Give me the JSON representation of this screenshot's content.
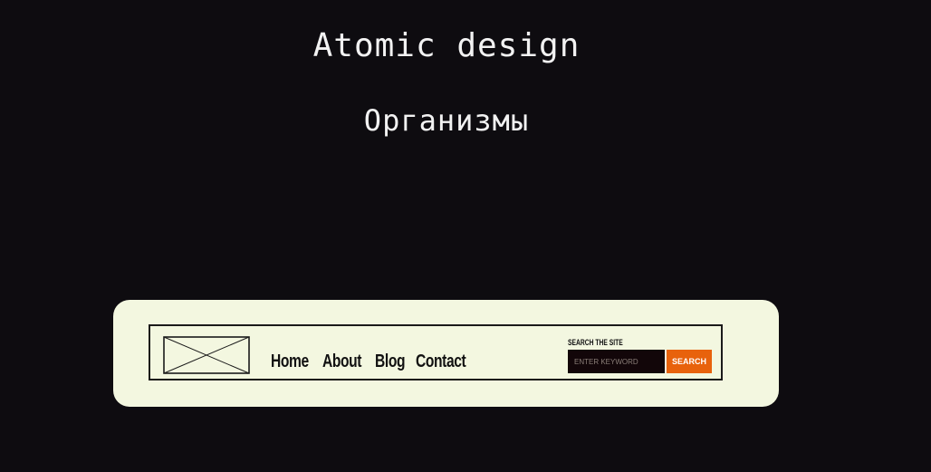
{
  "slide": {
    "title": "Atomic design",
    "subtitle": "Организмы"
  },
  "header": {
    "logo_icon": "image-placeholder-icon",
    "nav": [
      {
        "label": "Home"
      },
      {
        "label": "About"
      },
      {
        "label": "Blog"
      },
      {
        "label": "Contact"
      }
    ],
    "search": {
      "label": "SEARCH THE SITE",
      "placeholder": "ENTER KEYWORD",
      "button_label": "SEARCH"
    }
  },
  "colors": {
    "background": "#0e0c10",
    "card": "#f3f7e0",
    "accent": "#e8620c",
    "input_bg": "#120609"
  }
}
